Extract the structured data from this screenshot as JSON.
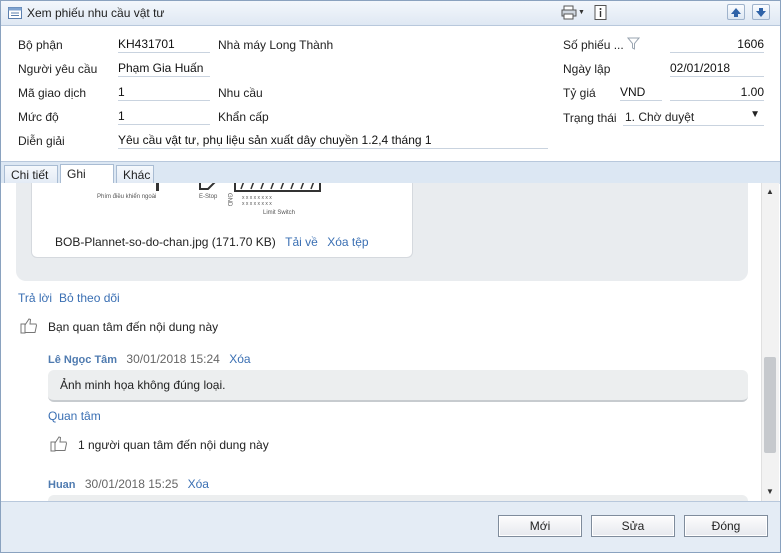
{
  "window": {
    "title": "Xem phiếu nhu cầu vật tư"
  },
  "form": {
    "bo_phan": {
      "label": "Bộ phận",
      "code": "KH431701",
      "name": "Nhà máy Long Thành"
    },
    "nguoi_yeu_cau": {
      "label": "Người yêu cầu",
      "value": "Phạm Gia Huấn"
    },
    "ma_giao_dich": {
      "label": "Mã giao dịch",
      "value": "1",
      "name": "Nhu cầu"
    },
    "muc_do": {
      "label": "Mức độ",
      "value": "1",
      "name": "Khẩn cấp"
    },
    "dien_giai": {
      "label": "Diễn giải",
      "value": "Yêu cầu vật tư, phụ liệu sản xuất dây chuyền 1.2,4 tháng 1"
    },
    "so_phieu": {
      "label": "Số phiếu ...",
      "value": "1606"
    },
    "ngay_lap": {
      "label": "Ngày lập",
      "value": "02/01/2018"
    },
    "ty_gia": {
      "label": "Tỷ giá",
      "currency": "VND",
      "value": "1.00"
    },
    "trang_thai": {
      "label": "Trạng thái",
      "value": "1. Chờ duyệt"
    }
  },
  "tabs": [
    {
      "label": "Chi tiết"
    },
    {
      "label": "Ghi chú"
    },
    {
      "label": "Khác"
    }
  ],
  "attachment": {
    "diagram_labels": [
      "Phím điều khiển ngoài",
      "E-Stop",
      "Limit Switch",
      "GND"
    ],
    "file_name": "BOB-Plannet-so-do-chan.jpg",
    "file_size": "(171.70 KB)",
    "download_label": "Tải về",
    "delete_label": "Xóa tệp"
  },
  "post_actions": {
    "reply": "Trả lời",
    "unfollow": "Bỏ theo dõi",
    "like_text": "Bạn quan tâm đến nội dung này"
  },
  "comments": [
    {
      "author": "Lê Ngọc Tâm",
      "time": "30/01/2018 15:24",
      "delete": "Xóa",
      "text": "Ảnh minh họa không đúng loại.",
      "like_label": "Quan tâm",
      "likes_text": "1 người quan tâm đến nội dung này"
    },
    {
      "author": "Huan",
      "time": "30/01/2018 15:25",
      "delete": "Xóa"
    }
  ],
  "buttons": {
    "new": "Mới",
    "edit": "Sửa",
    "close": "Đóng"
  },
  "colors": {
    "link": "#3a6fb3",
    "author": "#4f7bb0",
    "footer_bg": "#e4ecf5",
    "titlebar_bg": "#dfe8f3"
  }
}
